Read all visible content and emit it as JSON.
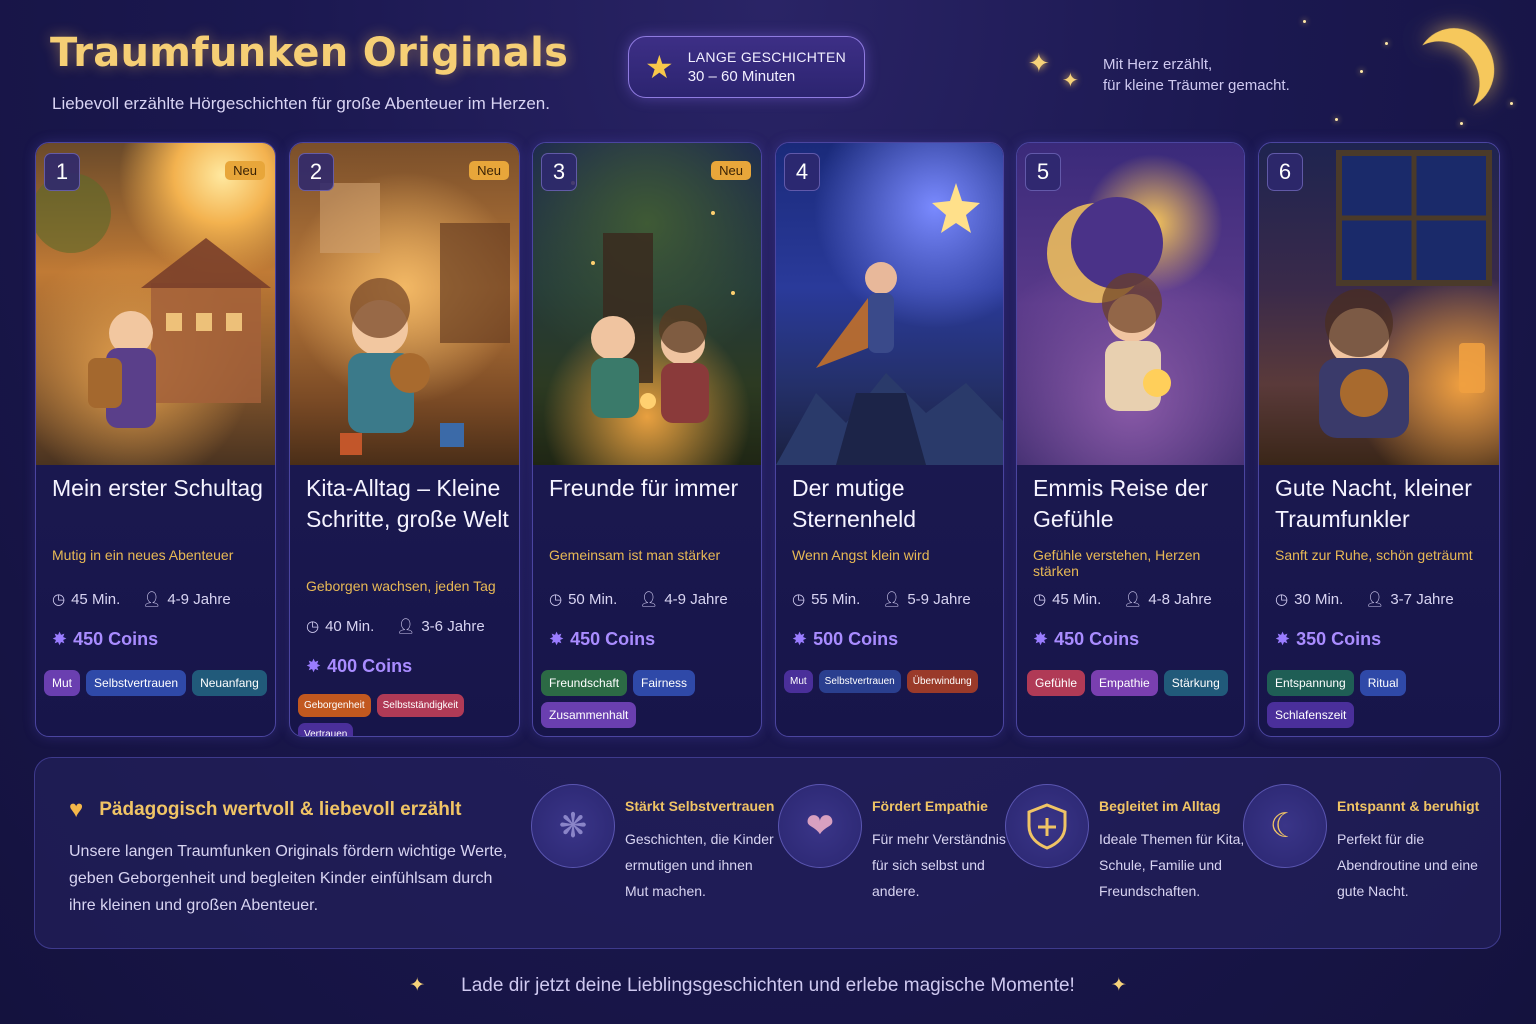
{
  "header": {
    "title": "Traumfunken Originals",
    "subtitle": "Liebevoll erzählte Hörgeschichten für große Abenteuer im Herzen.",
    "badge_line1": "LANGE GESCHICHTEN",
    "badge_line2": "30 – 60 Minuten",
    "tagline_line1": "Mit Herz erzählt,",
    "tagline_line2": "für kleine Träumer gemacht."
  },
  "cards": [
    {
      "number": "1",
      "badge": "Neu",
      "title": "Mein erster Schultag",
      "subtitle": "Mutig in ein neues Abenteuer",
      "duration": "45 Min.",
      "age": "4-9 Jahre",
      "coins": "450 Coins",
      "tags": [
        "Mut",
        "Selbstvertrauen",
        "Neuanfang"
      ],
      "tag_colors": [
        "#6a3fb0",
        "#2f49a8",
        "#215a7a"
      ]
    },
    {
      "number": "2",
      "badge": "Neu",
      "title": "Kita-Alltag – Kleine Schritte, große Welt",
      "subtitle": "Geborgen wachsen, jeden Tag",
      "duration": "40 Min.",
      "age": "3-6 Jahre",
      "coins": "400 Coins",
      "tags": [
        "Geborgenheit",
        "Selbstständigkeit",
        "Vertrauen"
      ],
      "tag_colors": [
        "#c2581f",
        "#b03a56",
        "#4a2f9a"
      ]
    },
    {
      "number": "3",
      "badge": "Neu",
      "title": "Freunde für immer",
      "subtitle": "Gemeinsam ist man stärker",
      "duration": "50 Min.",
      "age": "4-9 Jahre",
      "coins": "450 Coins",
      "tags": [
        "Freundschaft",
        "Fairness",
        "Zusammenhalt"
      ],
      "tag_colors": [
        "#2c6a45",
        "#2f49a8",
        "#6a3fb0"
      ]
    },
    {
      "number": "4",
      "badge": "",
      "title": "Der mutige Sternenheld",
      "subtitle": "Wenn Angst klein wird",
      "duration": "55 Min.",
      "age": "5-9 Jahre",
      "coins": "500 Coins",
      "tags": [
        "Mut",
        "Selbstvertrauen",
        "Überwindung"
      ],
      "tag_colors": [
        "#4a2f9a",
        "#2a3f8f",
        "#9a3a2a"
      ]
    },
    {
      "number": "5",
      "badge": "",
      "title": "Emmis Reise der Gefühle",
      "subtitle": "Gefühle verstehen, Herzen stärken",
      "duration": "45 Min.",
      "age": "4-8 Jahre",
      "coins": "450 Coins",
      "tags": [
        "Gefühle",
        "Empathie",
        "Stärkung"
      ],
      "tag_colors": [
        "#b03a56",
        "#7a3fb0",
        "#215a7a"
      ]
    },
    {
      "number": "6",
      "badge": "",
      "title": "Gute Nacht, kleiner Traumfunkler",
      "subtitle": "Sanft zur Ruhe, schön geträumt",
      "duration": "30 Min.",
      "age": "3-7 Jahre",
      "coins": "350 Coins",
      "tags": [
        "Entspannung",
        "Ritual",
        "Schlafenszeit"
      ],
      "tag_colors": [
        "#1f5e55",
        "#2f49a8",
        "#4a2f9a"
      ]
    }
  ],
  "bottom": {
    "heading": "Pädagogisch wertvoll & liebevoll erzählt",
    "text": "Unsere langen Traumfunken Originals fördern wichtige Werte, geben Geborgenheit und begleiten Kinder einfühlsam durch ihre kleinen und großen Abenteuer.",
    "features": [
      {
        "icon": "brain-icon",
        "title": "Stärkt Selbstvertrauen",
        "text": "Geschichten, die Kinder ermutigen und ihnen Mut machen."
      },
      {
        "icon": "people-heart-icon",
        "title": "Fördert Empathie",
        "text": "Für mehr Verständnis für sich selbst und andere."
      },
      {
        "icon": "shield-icon",
        "title": "Begleitet im Alltag",
        "text": "Ideale Themen für Kita, Schule, Familie und Freundschaften."
      },
      {
        "icon": "moon-stars-icon",
        "title": "Entspannt & beruhigt",
        "text": "Perfekt für die Abendroutine und eine gute Nacht."
      }
    ]
  },
  "footer": {
    "text": "Lade dir jetzt deine Lieblingsgeschichten und erlebe magische Momente!"
  },
  "colors": {
    "accent_gold": "#f6cf75",
    "coins_purple": "#a98cff",
    "background": "#1b1850"
  }
}
